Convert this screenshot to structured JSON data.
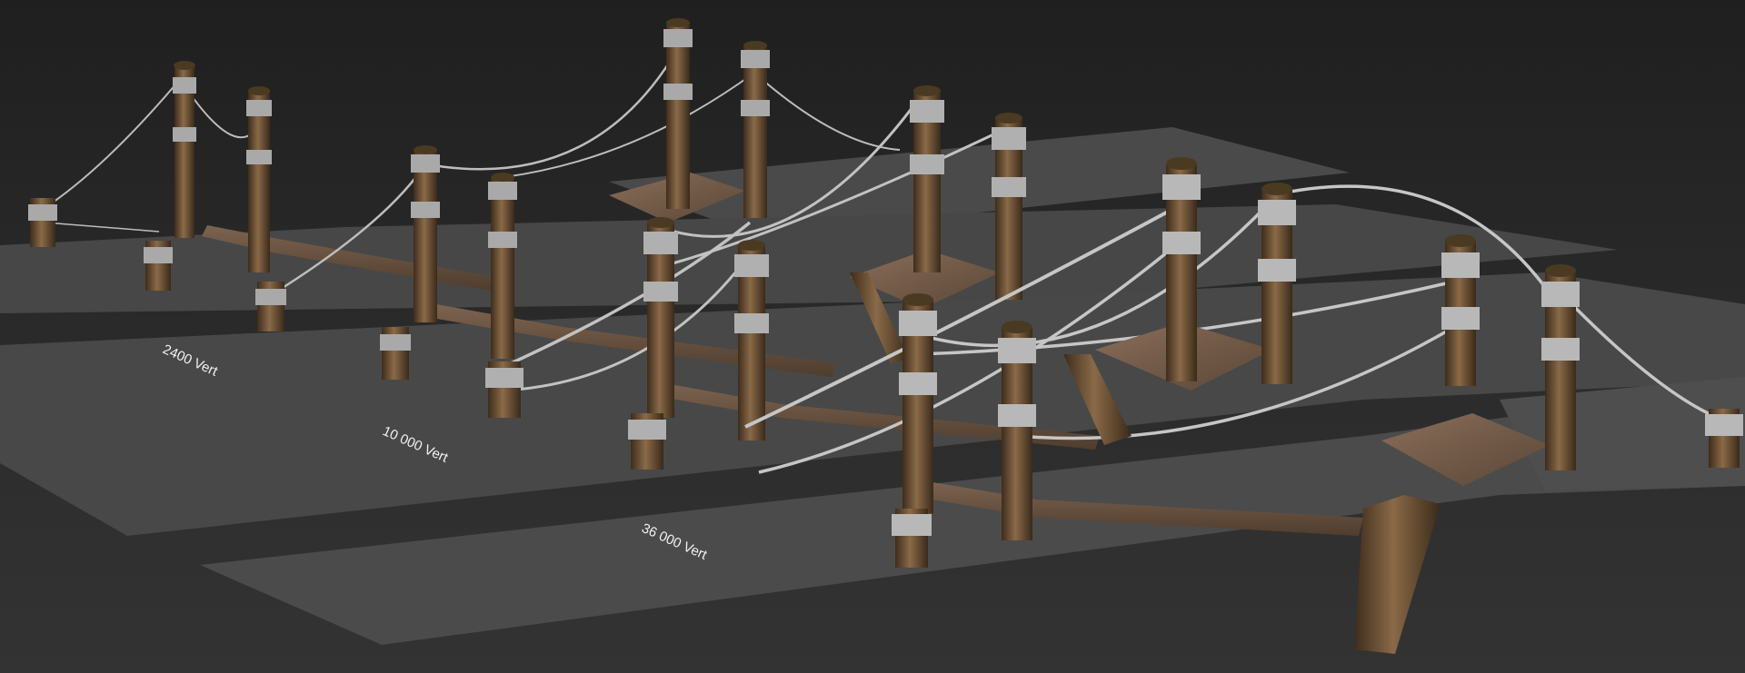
{
  "scene": {
    "background": "#2a2a2a",
    "plane_color": "#4a4a4a",
    "wood_color": "#6b4e33",
    "rope_color": "#b9b9b9",
    "plank_color": "#6e5644"
  },
  "labels": {
    "lod_2": "2400 Vert",
    "lod_3": "10 000 Vert",
    "lod_4": "36 000 Vert"
  }
}
